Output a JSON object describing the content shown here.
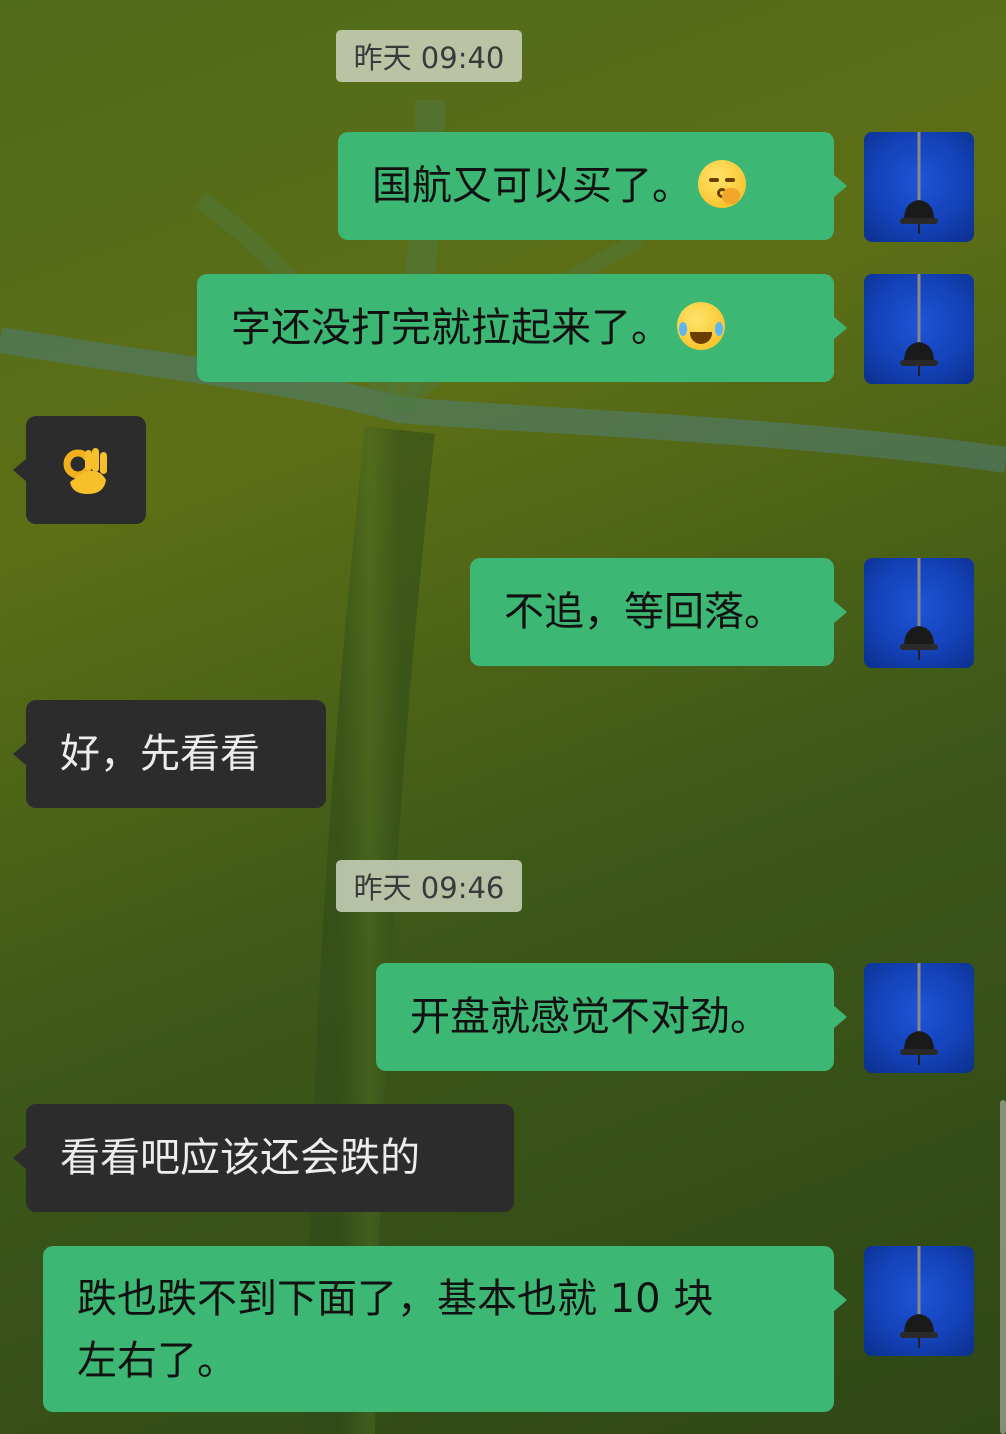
{
  "timestamps": [
    "昨天 09:40",
    "昨天 09:46"
  ],
  "messages": [
    {
      "side": "out",
      "text": "国航又可以买了。",
      "emoji": "shushing-face-icon"
    },
    {
      "side": "out",
      "text": "字还没打完就拉起来了。",
      "emoji": "rolling-on-floor-laughing-icon"
    },
    {
      "side": "in",
      "emoji": "ok-hand-icon"
    },
    {
      "side": "out",
      "text": "不追，等回落。"
    },
    {
      "side": "in",
      "text": "好，先看看"
    },
    {
      "side": "out",
      "text": "开盘就感觉不对劲。"
    },
    {
      "side": "in",
      "text": "看看吧应该还会跌的"
    },
    {
      "side": "out",
      "lines": [
        "跌也跌不到下面了，基本也就 10 块",
        "左右了。"
      ]
    }
  ],
  "avatar": {
    "icon": "bell-avatar-icon",
    "bg_color": "#1442b8"
  },
  "colors": {
    "outgoing_bubble": "#3db874",
    "incoming_bubble": "#2c2c2c",
    "timestamp_bg": "#cdd4be"
  }
}
